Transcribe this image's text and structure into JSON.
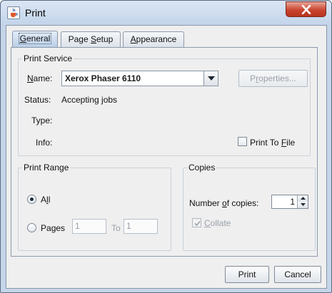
{
  "window": {
    "title": "Print",
    "icons": {
      "app": "java-cup-icon",
      "close": "close-icon"
    }
  },
  "tabs": [
    {
      "label_pre": "",
      "label_u": "G",
      "label_post": "eneral",
      "selected": true
    },
    {
      "label_pre": "Page ",
      "label_u": "S",
      "label_post": "etup",
      "selected": false
    },
    {
      "label_pre": "",
      "label_u": "A",
      "label_post": "ppearance",
      "selected": false
    }
  ],
  "print_service": {
    "title": "Print Service",
    "name_label_u": "N",
    "name_label_post": "ame:",
    "printer": "Xerox Phaser 6110",
    "properties_pre": "P",
    "properties_u": "r",
    "properties_post": "operties...",
    "status_label": "Status:",
    "status_value": "Accepting jobs",
    "type_label": "Type:",
    "info_label": "Info:",
    "print_to_file_pre": "Print To ",
    "print_to_file_u": "F",
    "print_to_file_post": "ile",
    "print_to_file_checked": false
  },
  "print_range": {
    "title": "Print Range",
    "all_pre": "A",
    "all_u": "l",
    "all_post": "l",
    "all_selected": true,
    "pages_pre": "Pa",
    "pages_u": "g",
    "pages_post": "es",
    "from_value": "1",
    "to_label": "To",
    "to_value": "1"
  },
  "copies": {
    "title": "Copies",
    "number_label_pre": "Number ",
    "number_label_u": "o",
    "number_label_post": "f copies:",
    "number_value": "1",
    "collate_pre": "",
    "collate_u": "C",
    "collate_post": "ollate",
    "collate_checked": true
  },
  "actions": {
    "print": "Print",
    "cancel": "Cancel"
  },
  "colors": {
    "title_bar": "#c3d4ea",
    "close_button": "#c9452f",
    "dialog_background": "#efefef",
    "selected_tab": "#b8cde6"
  }
}
